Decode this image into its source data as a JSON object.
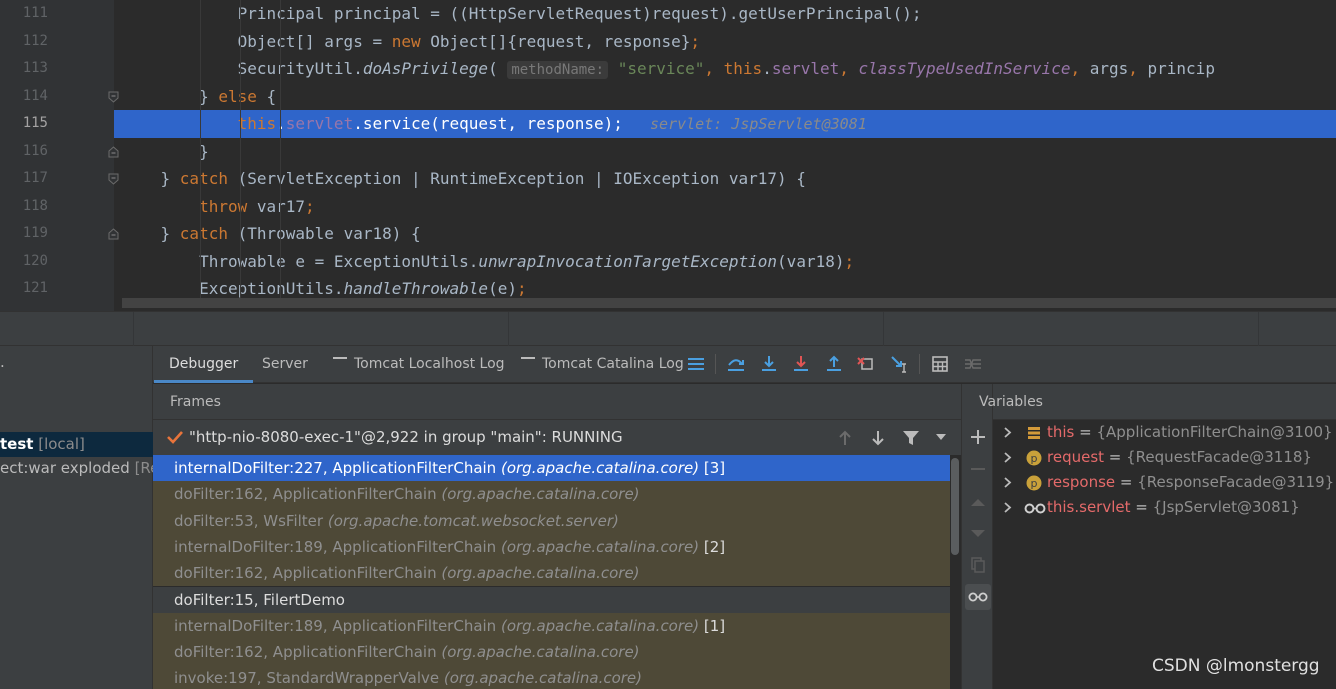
{
  "editor": {
    "lines": [
      {
        "num": "111",
        "segments": [
          {
            "t": "            Principal principal = ((HttpServletRequest)request).getUserPrincipal();",
            "c": ""
          }
        ]
      },
      {
        "num": "112",
        "segments": [
          {
            "t": "            Object[] args = ",
            "c": ""
          },
          {
            "t": "new",
            "c": "kw"
          },
          {
            "t": " Object[]{request, response}",
            "c": ""
          },
          {
            "t": ";",
            "c": "kw"
          }
        ]
      },
      {
        "num": "113",
        "segments": [
          {
            "t": "            SecurityUtil.",
            "c": ""
          },
          {
            "t": "doAsPrivilege",
            "c": "it"
          },
          {
            "t": "( ",
            "c": ""
          },
          {
            "t": "methodName:",
            "c": "hint"
          },
          {
            "t": " ",
            "c": ""
          },
          {
            "t": "\"service\"",
            "c": "str"
          },
          {
            "t": ", ",
            "c": "kw"
          },
          {
            "t": "this",
            "c": "kw"
          },
          {
            "t": ".",
            "c": ""
          },
          {
            "t": "servlet",
            "c": "fld"
          },
          {
            "t": ", ",
            "c": "kw"
          },
          {
            "t": "classTypeUsedInService",
            "c": "fld it"
          },
          {
            "t": ", ",
            "c": "kw"
          },
          {
            "t": "args",
            "c": ""
          },
          {
            "t": ", ",
            "c": "kw"
          },
          {
            "t": "princip",
            "c": ""
          }
        ]
      },
      {
        "num": "114",
        "segments": [
          {
            "t": "        } ",
            "c": ""
          },
          {
            "t": "else",
            "c": "kw"
          },
          {
            "t": " {",
            "c": ""
          }
        ]
      },
      {
        "num": "115",
        "current": true,
        "segments": [
          {
            "t": "            ",
            "c": ""
          },
          {
            "t": "this",
            "c": "kw"
          },
          {
            "t": ".",
            "c": ""
          },
          {
            "t": "servlet",
            "c": "fld"
          },
          {
            "t": ".service(request, response);",
            "c": ""
          },
          {
            "t": "   servlet: JspServlet@3081",
            "c": "inline-val"
          }
        ]
      },
      {
        "num": "116",
        "segments": [
          {
            "t": "        }",
            "c": ""
          }
        ]
      },
      {
        "num": "117",
        "segments": [
          {
            "t": "    } ",
            "c": ""
          },
          {
            "t": "catch",
            "c": "kw"
          },
          {
            "t": " (ServletException | RuntimeException | IOException var17) {",
            "c": ""
          }
        ]
      },
      {
        "num": "118",
        "segments": [
          {
            "t": "        ",
            "c": ""
          },
          {
            "t": "throw",
            "c": "kw"
          },
          {
            "t": " var17",
            "c": ""
          },
          {
            "t": ";",
            "c": "kw"
          }
        ]
      },
      {
        "num": "119",
        "segments": [
          {
            "t": "    } ",
            "c": ""
          },
          {
            "t": "catch",
            "c": "kw"
          },
          {
            "t": " (Throwable var18) {",
            "c": ""
          }
        ]
      },
      {
        "num": "120",
        "segments": [
          {
            "t": "        Throwable e = ExceptionUtils.",
            "c": ""
          },
          {
            "t": "unwrapInvocationTargetException",
            "c": "it"
          },
          {
            "t": "(var18)",
            "c": ""
          },
          {
            "t": ";",
            "c": "kw"
          }
        ]
      },
      {
        "num": "121",
        "segments": [
          {
            "t": "        ExceptionUtils.",
            "c": ""
          },
          {
            "t": "handleThrowable",
            "c": "it"
          },
          {
            "t": "(e)",
            "c": ""
          },
          {
            "t": ";",
            "c": "kw"
          }
        ]
      }
    ]
  },
  "services": {
    "row0": ".",
    "selected_name": "test",
    "selected_tag": "[local]",
    "artifact": "ect:war exploded",
    "artifact_tag": "[Re"
  },
  "tabs": {
    "debugger": "Debugger",
    "server": "Server",
    "tomcat_localhost_log": "Tomcat Localhost Log",
    "tomcat_catalina_log": "Tomcat Catalina Log"
  },
  "frames": {
    "title": "Frames",
    "thread": "\"http-nio-8080-exec-1\"@2,922 in group \"main\": RUNNING",
    "items": [
      {
        "method": "internalDoFilter:227, ApplicationFilterChain",
        "pkg": "(org.apache.catalina.core)",
        "count": "[3]",
        "kind": "sel"
      },
      {
        "method": "doFilter:162, ApplicationFilterChain",
        "pkg": "(org.apache.catalina.core)",
        "count": "",
        "kind": "lib"
      },
      {
        "method": "doFilter:53, WsFilter",
        "pkg": "(org.apache.tomcat.websocket.server)",
        "count": "",
        "kind": "lib"
      },
      {
        "method": "internalDoFilter:189, ApplicationFilterChain",
        "pkg": "(org.apache.catalina.core)",
        "count": "[2]",
        "kind": "lib"
      },
      {
        "method": "doFilter:162, ApplicationFilterChain",
        "pkg": "(org.apache.catalina.core)",
        "count": "",
        "kind": "lib"
      },
      {
        "method": "doFilter:15, FilertDemo",
        "pkg": "",
        "count": "",
        "kind": "user"
      },
      {
        "method": "internalDoFilter:189, ApplicationFilterChain",
        "pkg": "(org.apache.catalina.core)",
        "count": "[1]",
        "kind": "lib"
      },
      {
        "method": "doFilter:162, ApplicationFilterChain",
        "pkg": "(org.apache.catalina.core)",
        "count": "",
        "kind": "lib"
      },
      {
        "method": "invoke:197, StandardWrapperValve",
        "pkg": "(org.apache.catalina.core)",
        "count": "",
        "kind": "lib"
      }
    ]
  },
  "variables": {
    "title": "Variables",
    "items": [
      {
        "name": "this",
        "eq": " = ",
        "value": "{ApplicationFilterChain@3100}",
        "icon": "stack-icon"
      },
      {
        "name": "request",
        "eq": " = ",
        "value": "{RequestFacade@3118}",
        "icon": "parameter-icon"
      },
      {
        "name": "response",
        "eq": " = ",
        "value": "{ResponseFacade@3119}",
        "icon": "parameter-icon"
      },
      {
        "name": "this.servlet",
        "eq": " = ",
        "value": "{JspServlet@3081}",
        "icon": "watch-icon"
      }
    ]
  },
  "icons": {
    "param_letter": "p"
  },
  "watermark": "CSDN @lmonstergg",
  "colors": {
    "accent": "#2f65ca",
    "keyword": "#cc7832",
    "field": "#9876aa",
    "string": "#6a8759",
    "lib_frame": "#4e4937",
    "var_name": "#e46a6a"
  }
}
